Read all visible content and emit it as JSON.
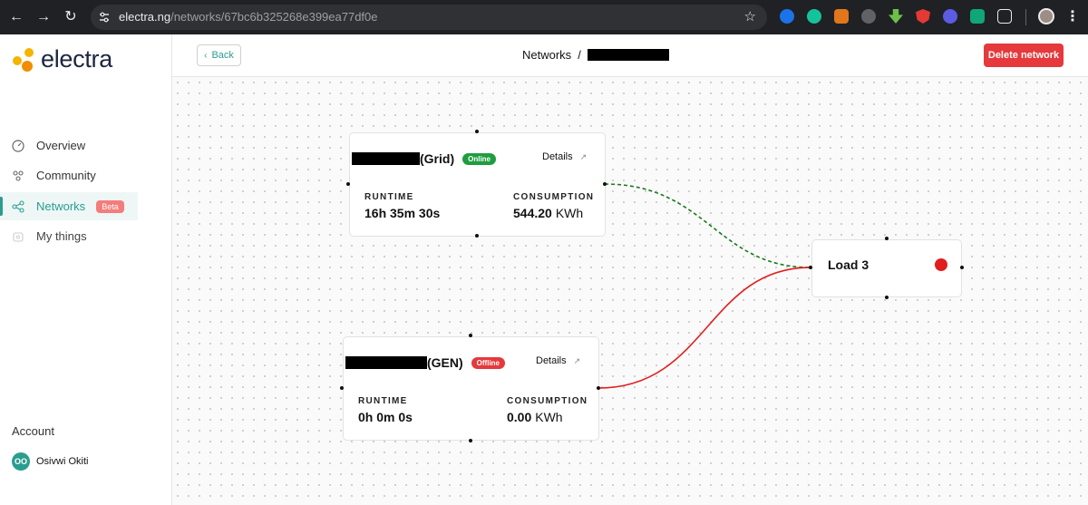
{
  "browser": {
    "url_domain": "electra.ng",
    "url_path": "/networks/67bc6b325268e399ea77df0e"
  },
  "app": {
    "brand": "electra",
    "brand_color": "#2a9d8f",
    "logo_colors": [
      "#f5b400",
      "#f28c00"
    ]
  },
  "sidebar": {
    "items": [
      {
        "label": "Overview",
        "icon": "gauge-icon"
      },
      {
        "label": "Community",
        "icon": "community-icon"
      },
      {
        "label": "Networks",
        "icon": "network-icon",
        "badge": "Beta",
        "active": true
      },
      {
        "label": "My things",
        "icon": "box-icon"
      }
    ],
    "account_label": "Account",
    "user": {
      "initials": "OO",
      "name": "Osivwi Okiti"
    }
  },
  "header": {
    "back_label": "Back",
    "breadcrumb_root": "Networks",
    "breadcrumb_sep": "/",
    "delete_label": "Delete network"
  },
  "nodes": {
    "grid": {
      "title_suffix": "(Grid)",
      "status": "Online",
      "details_label": "Details",
      "runtime_label": "RUNTIME",
      "runtime_value": "16h 35m 30s",
      "consumption_label": "CONSUMPTION",
      "consumption_value": "544.20",
      "consumption_unit": "KWh"
    },
    "gen": {
      "title_suffix": "(GEN)",
      "status": "Offline",
      "details_label": "Details",
      "runtime_label": "RUNTIME",
      "runtime_value": "0h 0m 0s",
      "consumption_label": "CONSUMPTION",
      "consumption_value": "0.00",
      "consumption_unit": "KWh"
    },
    "load": {
      "title": "Load 3",
      "status_color": "#e01e1e"
    }
  },
  "edges": {
    "grid_to_load": {
      "style": "dashed",
      "color": "#1a7a1a"
    },
    "gen_to_load": {
      "style": "solid",
      "color": "#e01e1e"
    }
  }
}
